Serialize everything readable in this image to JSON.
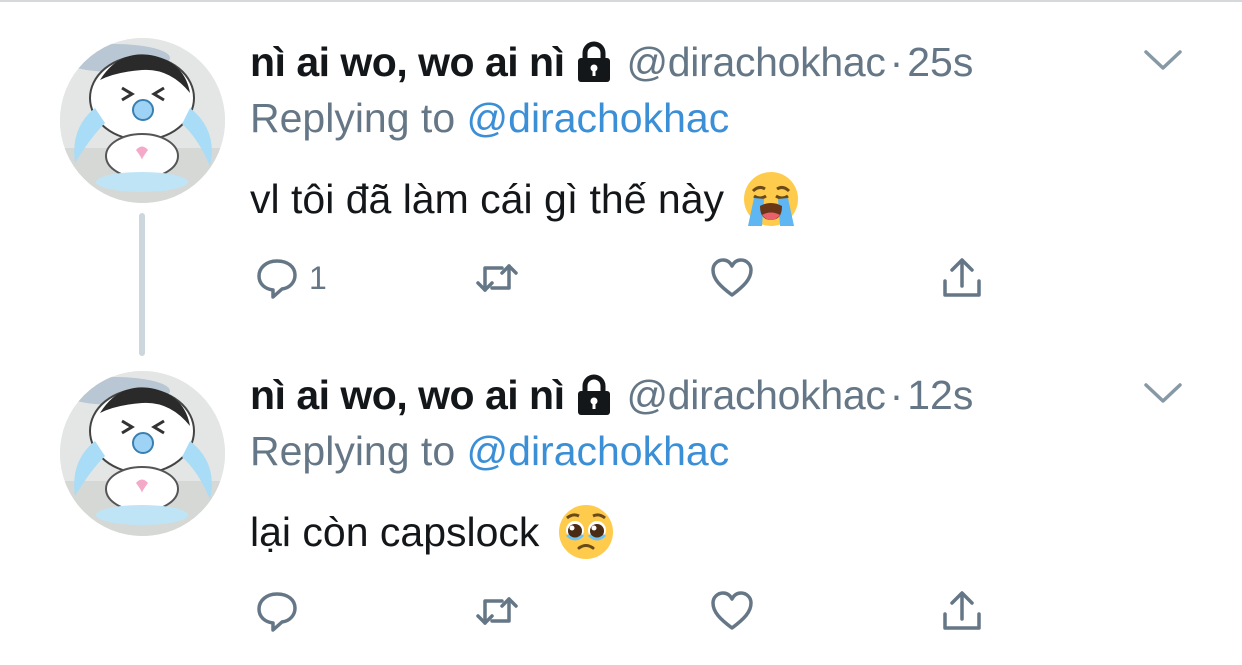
{
  "tweets": [
    {
      "display_name": "nì ai wo, wo ai nì",
      "handle": "@dirachokhac",
      "separator": "·",
      "time": "25s",
      "replying_prefix": "Replying to ",
      "replying_to": "@dirachokhac",
      "text": "vl tôi đã làm cái gì thế này",
      "emoji": "loudly-crying-face",
      "reply_count": "1"
    },
    {
      "display_name": "nì ai wo, wo ai nì",
      "handle": "@dirachokhac",
      "separator": "·",
      "time": "12s",
      "replying_prefix": "Replying to ",
      "replying_to": "@dirachokhac",
      "text": "lại còn capslock",
      "emoji": "pleading-face",
      "reply_count": ""
    }
  ],
  "colors": {
    "text_primary": "#14171a",
    "text_secondary": "#657786",
    "mention": "#3a8fd6",
    "thread_line": "#ccd6dd"
  },
  "icons": [
    "lock-icon",
    "chevron-down-icon",
    "reply-icon",
    "retweet-icon",
    "like-icon",
    "share-icon"
  ]
}
